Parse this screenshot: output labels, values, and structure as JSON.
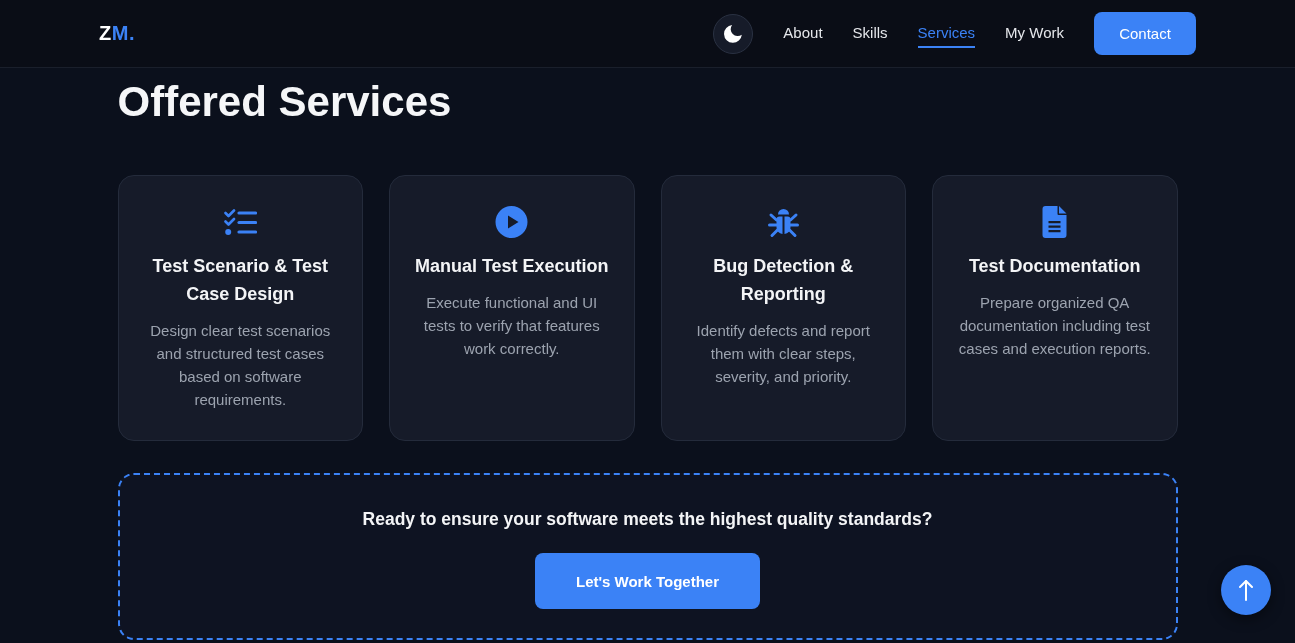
{
  "header": {
    "logo": {
      "text": "Z",
      "accent": "M."
    },
    "nav": [
      {
        "label": "About",
        "selected": false
      },
      {
        "label": "Skills",
        "selected": false
      },
      {
        "label": "Services",
        "selected": true
      },
      {
        "label": "My Work",
        "selected": false
      }
    ],
    "contact_button": "Contact"
  },
  "services": {
    "title": "Offered Services",
    "cards": [
      {
        "kind": "checklist",
        "title": "Test Scenario & Test Case Design",
        "description": "Design clear test scenarios and structured test cases based on software requirements."
      },
      {
        "kind": "play",
        "title": "Manual Test Execution",
        "description": "Execute functional and UI tests to verify that features work correctly."
      },
      {
        "kind": "bug",
        "title": "Bug Detection & Reporting",
        "description": "Identify defects and report them with clear steps, severity, and priority."
      },
      {
        "kind": "document",
        "title": "Test Documentation",
        "description": "Prepare organized QA documentation including test cases and execution reports."
      }
    ]
  },
  "cta": {
    "text": "Ready to ensure your software meets the highest quality standards?",
    "button": "Let's Work Together"
  }
}
